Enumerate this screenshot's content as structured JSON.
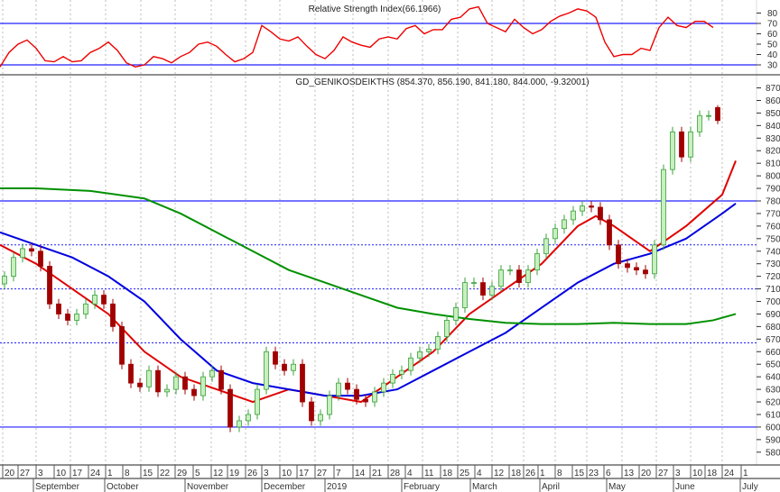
{
  "chart_data": {
    "type": "candlestick",
    "rsi": {
      "title": "Relative Strength Index(66.1966)",
      "levels": [
        70,
        30
      ],
      "yticks": [
        "80",
        "70",
        "60",
        "50",
        "40",
        "30"
      ],
      "ylim": [
        25,
        92
      ],
      "values": [
        28,
        42,
        50,
        54,
        46,
        34,
        33,
        38,
        33,
        34,
        42,
        46,
        52,
        44,
        32,
        28,
        30,
        38,
        36,
        32,
        38,
        42,
        50,
        52,
        48,
        40,
        33,
        36,
        42,
        68,
        62,
        55,
        53,
        57,
        48,
        40,
        36,
        44,
        57,
        52,
        49,
        47,
        55,
        57,
        55,
        65,
        68,
        60,
        64,
        64,
        74,
        76,
        84,
        86,
        70,
        66,
        62,
        74,
        66,
        60,
        64,
        72,
        77,
        80,
        84,
        82,
        76,
        52,
        38,
        40,
        40,
        46,
        44,
        66,
        76,
        68,
        66,
        72,
        72,
        66
      ]
    },
    "price": {
      "title": "GD_GENIKOSDEIKTHS (854.370, 856.190, 841.180, 844.000, -9.32001)",
      "yticks": [
        "870",
        "860",
        "850",
        "840",
        "830",
        "820",
        "810",
        "800",
        "790",
        "780",
        "770",
        "760",
        "750",
        "740",
        "730",
        "720",
        "710",
        "700",
        "690",
        "680",
        "670",
        "660",
        "650",
        "640",
        "630",
        "620",
        "610",
        "600",
        "590",
        "580"
      ],
      "ylim": [
        577,
        872
      ],
      "solid_levels": [
        780,
        600
      ],
      "dotted_levels": [
        745,
        710,
        667
      ],
      "closes": [
        720,
        735,
        742,
        740,
        728,
        698,
        690,
        685,
        690,
        698,
        705,
        698,
        680,
        650,
        635,
        632,
        645,
        628,
        630,
        640,
        630,
        625,
        640,
        645,
        630,
        600,
        605,
        610,
        630,
        660,
        650,
        645,
        650,
        620,
        605,
        610,
        625,
        635,
        630,
        622,
        620,
        628,
        635,
        642,
        645,
        655,
        660,
        662,
        672,
        685,
        695,
        715,
        715,
        705,
        712,
        725,
        725,
        715,
        725,
        738,
        750,
        758,
        765,
        772,
        776,
        775,
        765,
        745,
        730,
        727,
        725,
        722,
        745,
        805,
        835,
        815,
        835,
        848,
        848,
        844
      ],
      "last_bar": {
        "open": 854.37,
        "high": 856.19,
        "low": 841.18,
        "close": 844.0,
        "change": -9.32001
      },
      "moving_averages": [
        {
          "name": "short",
          "color": "#e00000",
          "points": [
            [
              -0.5,
              745
            ],
            [
              3.5,
              730
            ],
            [
              7.5,
              710
            ],
            [
              11.5,
              690
            ],
            [
              15.5,
              660
            ],
            [
              19.5,
              640
            ],
            [
              23.5,
              630
            ],
            [
              27.5,
              620
            ],
            [
              31.5,
              630
            ],
            [
              35.5,
              625
            ],
            [
              39.5,
              620
            ],
            [
              43.5,
              640
            ],
            [
              47.5,
              660
            ],
            [
              51.5,
              690
            ],
            [
              55.5,
              710
            ],
            [
              59.5,
              730
            ],
            [
              63.5,
              760
            ],
            [
              65.5,
              768
            ],
            [
              67.5,
              760
            ],
            [
              71.5,
              740
            ],
            [
              75.5,
              760
            ],
            [
              79.5,
              785
            ],
            [
              81,
              812
            ]
          ]
        },
        {
          "name": "medium",
          "color": "#0000e0",
          "points": [
            [
              -0.5,
              755
            ],
            [
              3.5,
              745
            ],
            [
              7.5,
              735
            ],
            [
              11.5,
              720
            ],
            [
              15.5,
              700
            ],
            [
              19.5,
              670
            ],
            [
              23.5,
              645
            ],
            [
              27.5,
              635
            ],
            [
              31.5,
              630
            ],
            [
              35.5,
              625
            ],
            [
              39.5,
              625
            ],
            [
              43.5,
              630
            ],
            [
              47.5,
              645
            ],
            [
              51.5,
              660
            ],
            [
              55.5,
              675
            ],
            [
              59.5,
              695
            ],
            [
              63.5,
              715
            ],
            [
              67.5,
              730
            ],
            [
              71.5,
              738
            ],
            [
              75.5,
              750
            ],
            [
              79.5,
              770
            ],
            [
              81,
              778
            ]
          ]
        },
        {
          "name": "long",
          "color": "#009000",
          "points": [
            [
              -0.5,
              790
            ],
            [
              3.5,
              790
            ],
            [
              9.5,
              788
            ],
            [
              15.5,
              782
            ],
            [
              19.5,
              770
            ],
            [
              23.5,
              755
            ],
            [
              27.5,
              740
            ],
            [
              31.5,
              725
            ],
            [
              35.5,
              715
            ],
            [
              39.5,
              705
            ],
            [
              43.5,
              695
            ],
            [
              47.5,
              690
            ],
            [
              51.5,
              686
            ],
            [
              55.5,
              683
            ],
            [
              59.5,
              682
            ],
            [
              63.5,
              682
            ],
            [
              67.5,
              683
            ],
            [
              71.5,
              682
            ],
            [
              75.5,
              682
            ],
            [
              78.5,
              685
            ],
            [
              81,
              690
            ]
          ]
        }
      ]
    },
    "xaxis": {
      "day_ticks": [
        "20",
        "27",
        "3",
        "10",
        "17",
        "24",
        "1",
        "8",
        "15",
        "22",
        "29",
        "5",
        "12",
        "19",
        "26",
        "3",
        "10",
        "17",
        "27",
        "7",
        "14",
        "21",
        "28",
        "4",
        "11",
        "18",
        "25",
        "4",
        "12",
        "18",
        "26",
        "1",
        "8",
        "15",
        "23",
        "6",
        "13",
        "20",
        "27",
        "3",
        "10",
        "18",
        "24",
        "1"
      ],
      "months": [
        "September",
        "October",
        "November",
        "December",
        "2019",
        "February",
        "March",
        "April",
        "May",
        "June",
        "July"
      ]
    },
    "colors": {
      "up": "#3aa03a",
      "up_fill": "#c8efc0",
      "down": "#a00000",
      "level": "#2020ff",
      "grid": "#bbbbbb"
    }
  }
}
